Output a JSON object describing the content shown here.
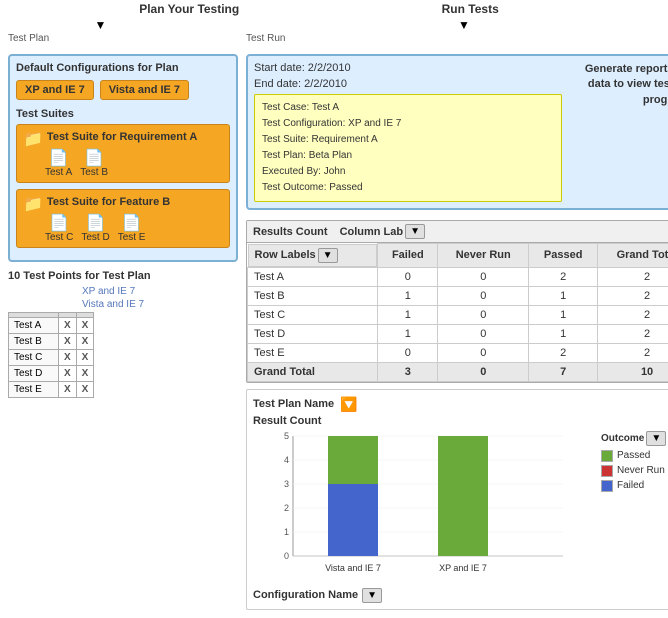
{
  "headers": {
    "plan_title": "Plan Your Testing",
    "run_title": "Run Tests",
    "test_plan_label": "Test Plan",
    "test_run_label": "Test Run"
  },
  "plan": {
    "title": "Default Configurations for Plan",
    "configs": [
      "XP and IE 7",
      "Vista and IE 7"
    ]
  },
  "suites": {
    "title": "Test Suites",
    "items": [
      {
        "name": "Test Suite for Requirement A",
        "tests": [
          "Test A",
          "Test B"
        ]
      },
      {
        "name": "Test Suite for Feature B",
        "tests": [
          "Test C",
          "Test D",
          "Test E"
        ]
      }
    ]
  },
  "test_points": {
    "title": "10 Test Points for Test Plan",
    "config_labels": [
      "XP and IE 7",
      "Vista and IE 7"
    ],
    "rows": [
      {
        "name": "Test A",
        "vals": [
          "X",
          "X"
        ]
      },
      {
        "name": "Test B",
        "vals": [
          "X",
          "X"
        ]
      },
      {
        "name": "Test C",
        "vals": [
          "X",
          "X"
        ]
      },
      {
        "name": "Test D",
        "vals": [
          "X",
          "X"
        ]
      },
      {
        "name": "Test E",
        "vals": [
          "X",
          "X"
        ]
      }
    ]
  },
  "run": {
    "start_date": "Start date: 2/2/2010",
    "end_date": "End date: 2/2/2010",
    "tooltip": {
      "test_case": "Test Case: Test A",
      "test_config": "Test Configuration: XP and IE 7",
      "test_suite": "Test Suite: Requirement A",
      "test_plan": "Test Plan: Beta Plan",
      "executed_by": "Executed By: John",
      "test_outcome": "Test Outcome: Passed"
    }
  },
  "generate": {
    "text": "Generate reports on data to view testing progress"
  },
  "results": {
    "header": "Results Count",
    "col_lab": "Column Lab",
    "columns": [
      "Row Labels",
      "Failed",
      "Never Run",
      "Passed",
      "Grand Total"
    ],
    "rows": [
      {
        "label": "Test A",
        "failed": 0,
        "never_run": 0,
        "passed": 2,
        "total": 2
      },
      {
        "label": "Test B",
        "failed": 1,
        "never_run": 0,
        "passed": 1,
        "total": 2
      },
      {
        "label": "Test C",
        "failed": 1,
        "never_run": 0,
        "passed": 1,
        "total": 2
      },
      {
        "label": "Test D",
        "failed": 1,
        "never_run": 0,
        "passed": 1,
        "total": 2
      },
      {
        "label": "Test E",
        "failed": 0,
        "never_run": 0,
        "passed": 2,
        "total": 2
      },
      {
        "label": "Grand Total",
        "failed": 3,
        "never_run": 0,
        "passed": 7,
        "total": 10
      }
    ]
  },
  "chart": {
    "title": "Test Plan Name",
    "y_label": "Result Count",
    "x_label": "Configuration Name",
    "bars": [
      {
        "label": "Vista and IE 7",
        "failed": 3,
        "never_run": 0,
        "passed": 2
      },
      {
        "label": "XP and IE 7",
        "failed": 0,
        "never_run": 0,
        "passed": 5
      }
    ],
    "legend": {
      "title": "Outcome",
      "items": [
        {
          "label": "Passed",
          "color": "#6aaa3a"
        },
        {
          "label": "Never Run",
          "color": "#cc3333"
        },
        {
          "label": "Failed",
          "color": "#4466cc"
        }
      ]
    },
    "y_ticks": [
      "0",
      "1",
      "2",
      "3",
      "4",
      "5"
    ]
  }
}
